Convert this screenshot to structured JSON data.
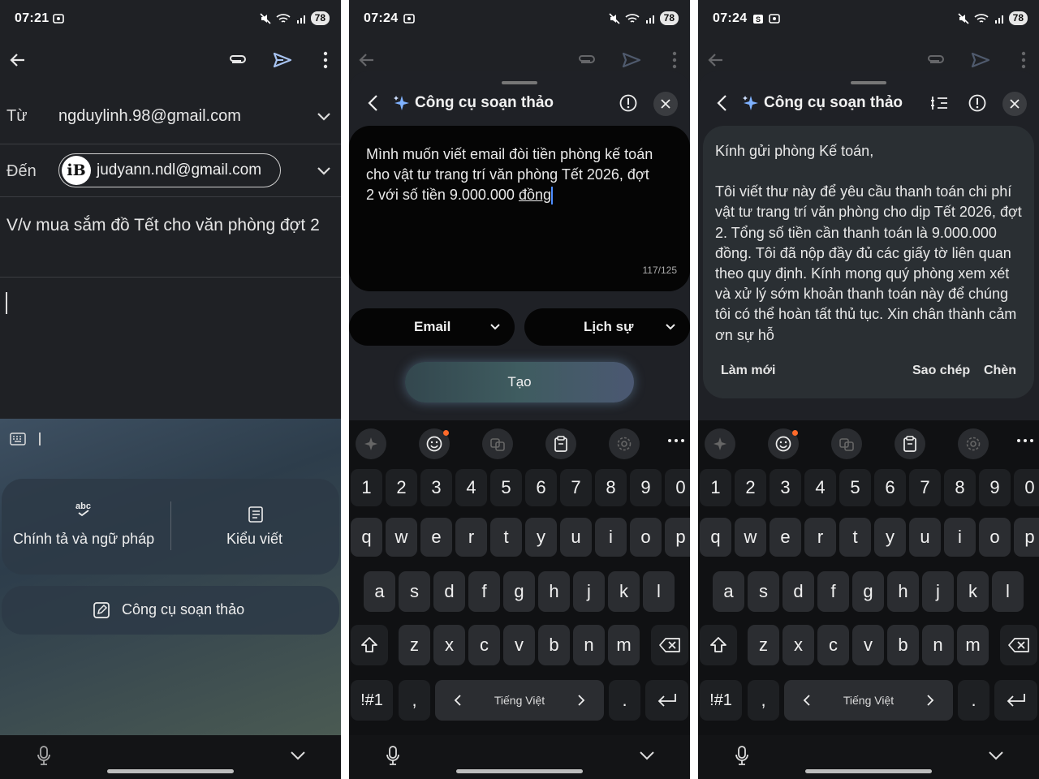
{
  "phone1": {
    "status": {
      "time": "07:21",
      "battery": "78"
    },
    "from_label": "Từ",
    "from_value": "ngduylinh.98@gmail.com",
    "to_label": "Đến",
    "to_chip": "judyann.ndl@gmail.com",
    "subject": "V/v mua sắm đồ Tết cho văn phòng đợt 2",
    "spell_label": "Chính tả và ngữ pháp",
    "style_label": "Kiểu viết",
    "composer_label": "Công cụ soạn thảo"
  },
  "phone2": {
    "status": {
      "time": "07:24",
      "battery": "78"
    },
    "title": "Công cụ soạn thảo",
    "prompt": "Mình muốn viết email đòi tiền phòng kế toán cho vật tư trang trí văn phòng Tết 2026, đợt 2 với số tiền 9.000.000 ",
    "prompt_last": "đồng",
    "counter": "117/125",
    "format_select": "Email",
    "tone_select": "Lịch sự",
    "generate": "Tạo"
  },
  "phone3": {
    "status": {
      "time": "07:24",
      "battery": "78"
    },
    "title": "Công cụ soạn thảo",
    "result_greeting": "Kính gửi phòng Kế toán,",
    "result_body": "Tôi viết thư này để yêu cầu thanh toán chi phí vật tư trang trí văn phòng cho dịp Tết 2026, đợt 2. Tổng số tiền cần thanh toán là 9.000.000 đồng. Tôi đã nộp đầy đủ các giấy tờ liên quan theo quy định. Kính mong quý phòng xem xét và xử lý sớm khoản thanh toán này để chúng tôi có thể hoàn tất thủ tục. Xin chân thành cảm ơn sự hỗ",
    "refresh": "Làm mới",
    "copy": "Sao chép",
    "insert": "Chèn"
  },
  "keyboard": {
    "row_numbers": [
      "1",
      "2",
      "3",
      "4",
      "5",
      "6",
      "7",
      "8",
      "9",
      "0"
    ],
    "row_top": [
      "q",
      "w",
      "e",
      "r",
      "t",
      "y",
      "u",
      "i",
      "o",
      "p"
    ],
    "row_mid": [
      "a",
      "s",
      "d",
      "f",
      "g",
      "h",
      "j",
      "k",
      "l"
    ],
    "row_bottom": [
      "z",
      "x",
      "c",
      "v",
      "b",
      "n",
      "m"
    ],
    "symbols": "!#1",
    "comma": ",",
    "period": ".",
    "language": "Tiếng Việt"
  },
  "colors": {
    "background": "#1f2125",
    "keyboard": "#101113",
    "key": "#2b2d31",
    "accent_send": "#a8c4f2"
  }
}
